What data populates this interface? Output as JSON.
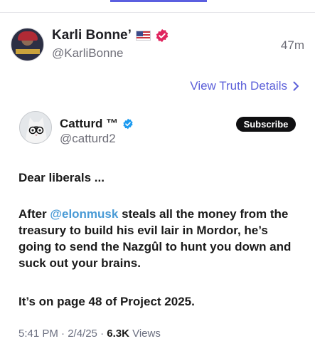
{
  "poster": {
    "name": "Karli Bonne’",
    "handle": "@KarliBonne",
    "time": "47m"
  },
  "view_details_label": "View Truth Details",
  "quoted": {
    "name": "Catturd ™",
    "handle": "@catturd2",
    "subscribe_label": "Subscribe"
  },
  "post": {
    "line1": "Dear liberals ...",
    "para2_before": "After ",
    "para2_mention": "@elonmusk",
    "para2_after": " steals all the money from the treasury to build his evil lair in Mordor, he’s going to send the Nazgûl to hunt you down and suck out your brains.",
    "para3": "It’s on page 48 of Project 2025."
  },
  "meta": {
    "timestamp": "5:41 PM · 2/4/25 · ",
    "views_count": "6.3K",
    "views_label": " Views"
  },
  "colors": {
    "accent": "#5b5fd9",
    "mention": "#4a9bd6",
    "verified_red": "#e0245e",
    "verified_blue": "#1d9bf0"
  },
  "icons": [
    "us-flag-icon",
    "verified-red-icon",
    "chevron-right-icon",
    "verified-blue-icon"
  ]
}
